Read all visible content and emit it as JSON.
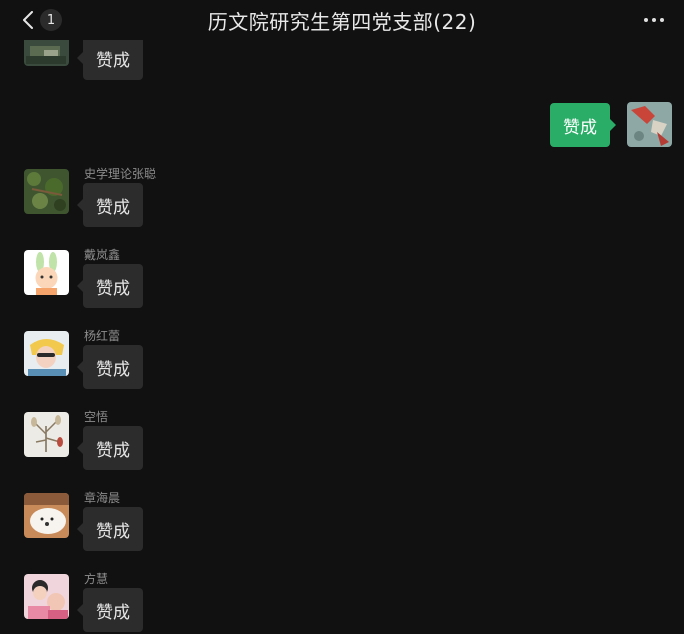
{
  "header": {
    "unread_count": "1",
    "title": "历文院研究生第四党支部(22)"
  },
  "colors": {
    "background": "#111111",
    "bubble_incoming": "#2c2c2c",
    "bubble_outgoing": "#2aae67",
    "nickname": "#8c8c8c"
  },
  "messages": [
    {
      "sender": "",
      "text": "赞成",
      "outgoing": false
    },
    {
      "sender": "",
      "text": "赞成",
      "outgoing": true
    },
    {
      "sender": "史学理论张聪",
      "text": "赞成",
      "outgoing": false
    },
    {
      "sender": "戴岚鑫",
      "text": "赞成",
      "outgoing": false
    },
    {
      "sender": "杨红蕾",
      "text": "赞成",
      "outgoing": false
    },
    {
      "sender": "空悟",
      "text": "赞成",
      "outgoing": false
    },
    {
      "sender": "章海晨",
      "text": "赞成",
      "outgoing": false
    },
    {
      "sender": "方慧",
      "text": "赞成",
      "outgoing": false
    }
  ]
}
